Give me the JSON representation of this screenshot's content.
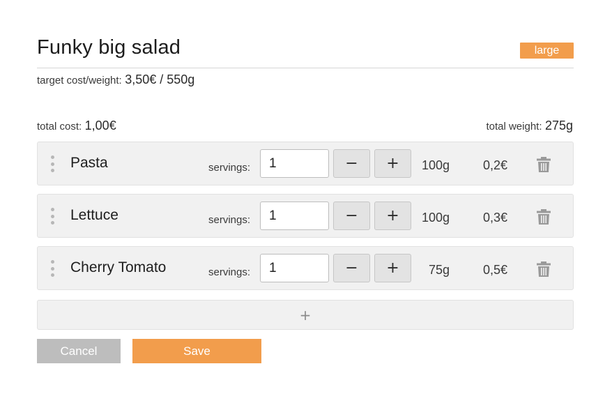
{
  "recipe": {
    "title": "Funky big salad",
    "size_badge": "large",
    "target_label": "target cost/weight:",
    "target_value": "3,50€ / 550g"
  },
  "totals": {
    "cost_label": "total cost:",
    "cost_value": "1,00€",
    "weight_label": "total weight:",
    "weight_value": "275g"
  },
  "ingredients": [
    {
      "name": "Pasta",
      "servings_label": "servings:",
      "servings": "1",
      "minus": "−",
      "plus": "+",
      "weight": "100g",
      "cost": "0,2€"
    },
    {
      "name": "Lettuce",
      "servings_label": "servings:",
      "servings": "1",
      "minus": "−",
      "plus": "+",
      "weight": "100g",
      "cost": "0,3€"
    },
    {
      "name": "Cherry Tomato",
      "servings_label": "servings:",
      "servings": "1",
      "minus": "−",
      "plus": "+",
      "weight": "75g",
      "cost": "0,5€"
    }
  ],
  "icons": {
    "drag": "drag-handle-icon",
    "delete": "trash-icon",
    "add": "plus-icon"
  },
  "add_row_label": "+",
  "actions": {
    "cancel_label": "Cancel",
    "save_label": "Save"
  },
  "colors": {
    "accent": "#f29d4c",
    "cancel": "#bdbdbd"
  }
}
